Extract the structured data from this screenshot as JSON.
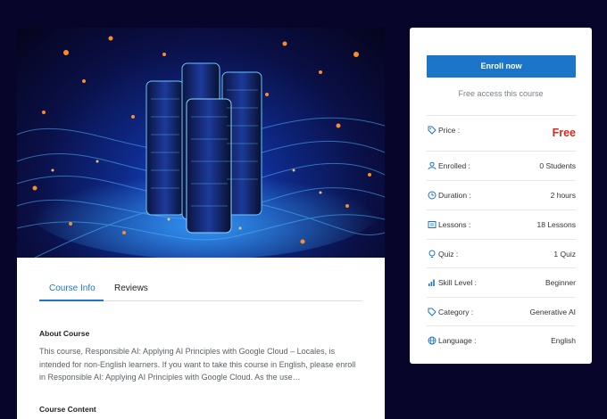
{
  "hero": {
    "image_name": "ai-data-center-illustration"
  },
  "tabs": [
    {
      "label": "Course Info",
      "active": true
    },
    {
      "label": "Reviews",
      "active": false
    }
  ],
  "about": {
    "title": "About Course",
    "text": "This course, Responsible AI: Applying AI Principles with Google Cloud – Locales, is intended for non-English learners. If you want to take this course in English, please enroll in Responsible AI: Applying AI Principles with Google Cloud. As the use…"
  },
  "content": {
    "title": "Course Content"
  },
  "sidebar": {
    "enroll_label": "Enroll now",
    "free_access": "Free access this course",
    "rows": [
      {
        "icon": "price-tag-icon",
        "label": "Price :",
        "value": "Free"
      },
      {
        "icon": "users-icon",
        "label": "Enrolled :",
        "value": "0 Students"
      },
      {
        "icon": "clock-icon",
        "label": "Duration :",
        "value": "2 hours"
      },
      {
        "icon": "lessons-icon",
        "label": "Lessons :",
        "value": "18 Lessons"
      },
      {
        "icon": "bulb-icon",
        "label": "Quiz :",
        "value": "1 Quiz"
      },
      {
        "icon": "bar-chart-icon",
        "label": "Skill Level :",
        "value": "Beginner"
      },
      {
        "icon": "tag-icon",
        "label": "Category :",
        "value": "Generative AI"
      },
      {
        "icon": "globe-icon",
        "label": "Language :",
        "value": "English"
      }
    ]
  },
  "colors": {
    "background": "#07052a",
    "accent": "#1d75c9",
    "price": "#e0231b"
  }
}
